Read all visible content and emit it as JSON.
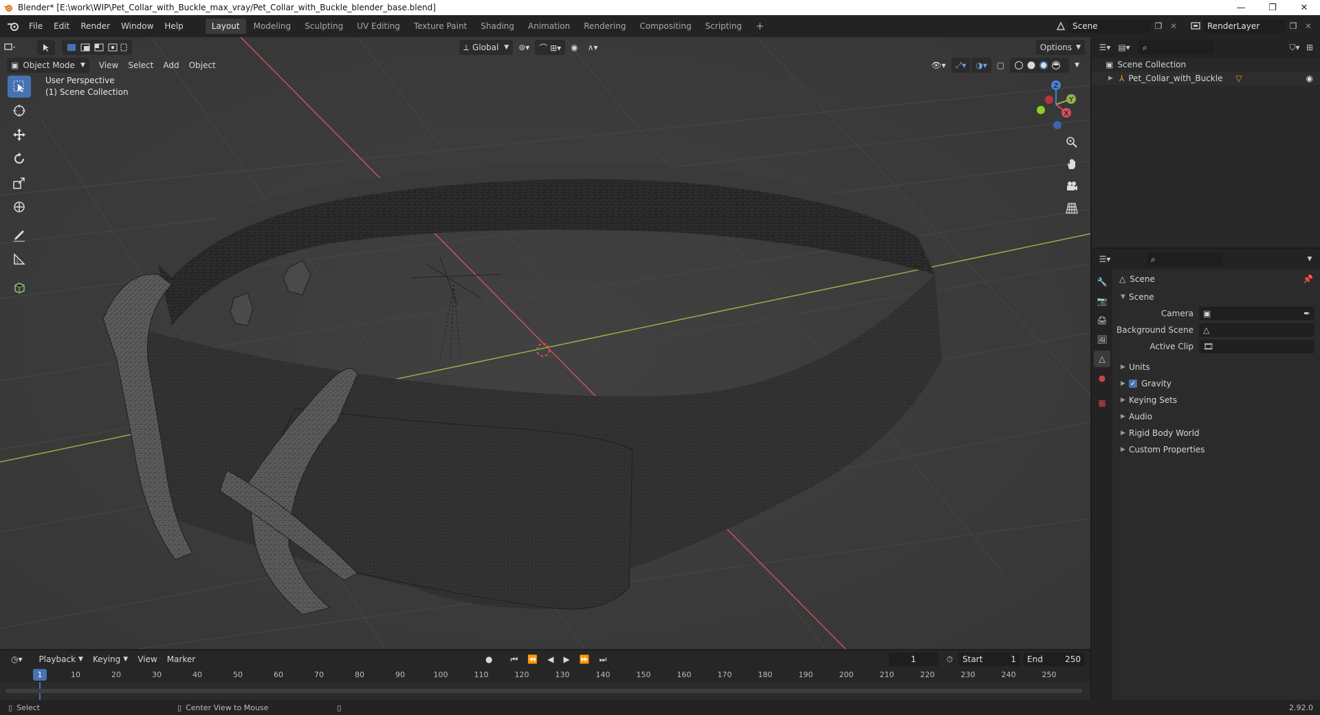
{
  "window": {
    "title": "Blender* [E:\\work\\WIP\\Pet_Collar_with_Buckle_max_vray/Pet_Collar_with_Buckle_blender_base.blend]",
    "controls": [
      "—",
      "❐",
      "✕"
    ]
  },
  "menubar": {
    "items": [
      "File",
      "Edit",
      "Render",
      "Window",
      "Help"
    ]
  },
  "workspaces": {
    "tabs": [
      "Layout",
      "Modeling",
      "Sculpting",
      "UV Editing",
      "Texture Paint",
      "Shading",
      "Animation",
      "Rendering",
      "Compositing",
      "Scripting"
    ],
    "active": "Layout",
    "add_label": "+"
  },
  "scene_selector": {
    "value": "Scene"
  },
  "renderlayer_selector": {
    "value": "RenderLayer"
  },
  "viewport": {
    "mode": "Object Mode",
    "menus": [
      "View",
      "Select",
      "Add",
      "Object"
    ],
    "transform_orientation": "Global",
    "options_label": "Options",
    "overlay_lines": [
      "User Perspective",
      "(1) Scene Collection"
    ],
    "gizmo_axes": {
      "x": "X",
      "y": "Y",
      "z": "Z"
    },
    "colors": {
      "background": "#3d3d3d",
      "x_axis": "#d44d5c",
      "y_axis": "#8fb34a",
      "active_tool": "#4772b3"
    }
  },
  "outliner": {
    "root": "Scene Collection",
    "items": [
      {
        "label": "Pet_Collar_with_Buckle"
      }
    ]
  },
  "properties": {
    "context_title": "Scene",
    "section_title": "Scene",
    "fields": [
      {
        "label": "Camera",
        "value": ""
      },
      {
        "label": "Background Scene",
        "value": ""
      },
      {
        "label": "Active Clip",
        "value": ""
      }
    ],
    "panels": [
      {
        "label": "Units"
      },
      {
        "label": "Gravity",
        "checked": true
      },
      {
        "label": "Keying Sets"
      },
      {
        "label": "Audio"
      },
      {
        "label": "Rigid Body World"
      },
      {
        "label": "Custom Properties"
      }
    ]
  },
  "timeline": {
    "menus": [
      "Playback",
      "Keying",
      "View",
      "Marker"
    ],
    "current_frame": "1",
    "start_label": "Start",
    "start_value": "1",
    "end_label": "End",
    "end_value": "250",
    "ruler": [
      "10",
      "20",
      "30",
      "40",
      "50",
      "60",
      "70",
      "80",
      "90",
      "100",
      "110",
      "120",
      "130",
      "140",
      "150",
      "160",
      "170",
      "180",
      "190",
      "200",
      "210",
      "220",
      "230",
      "240",
      "250"
    ],
    "playhead_label": "1"
  },
  "statusbar": {
    "left_action": "Select",
    "mid_action": "Center View to Mouse",
    "version": "2.92.0"
  }
}
